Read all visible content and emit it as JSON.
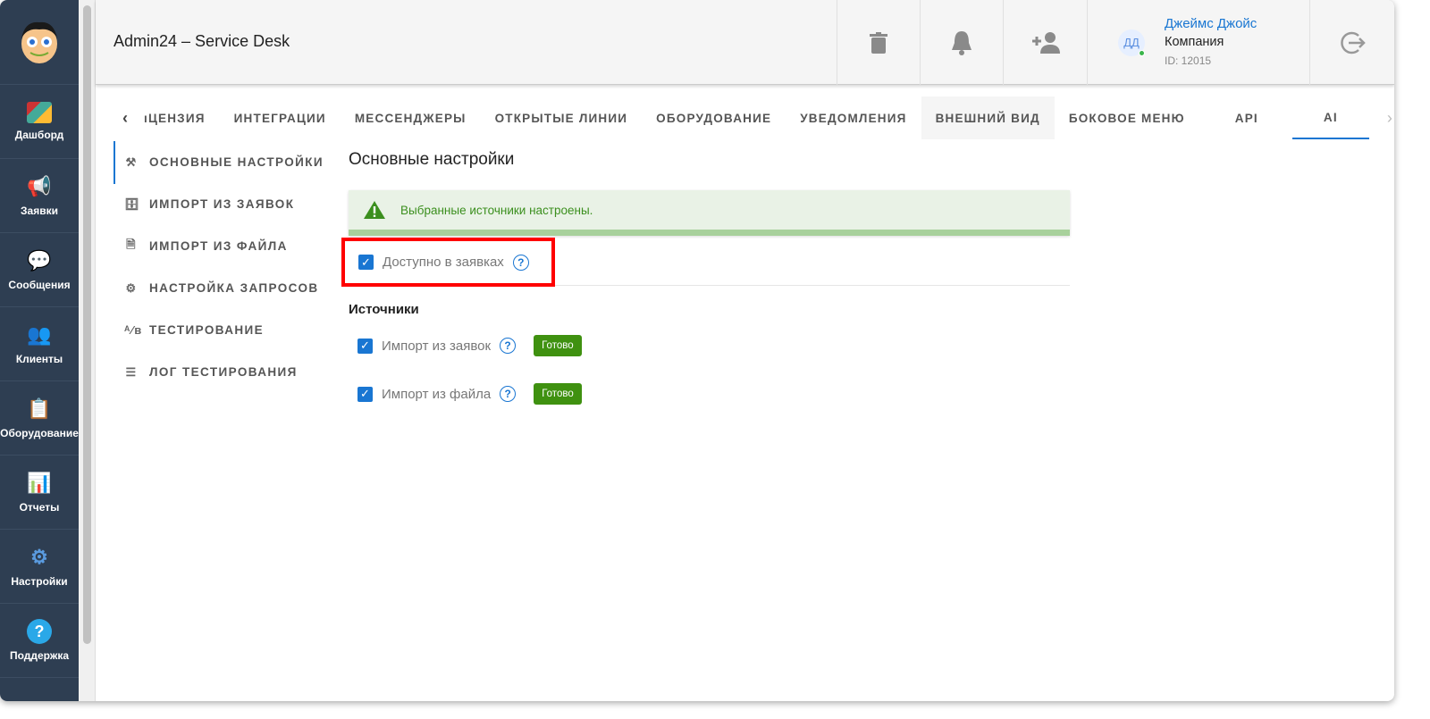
{
  "sidebar": {
    "items": [
      {
        "label": "Дашборд",
        "icon": "dashboard-icon"
      },
      {
        "label": "Заявки",
        "icon": "megaphone-icon"
      },
      {
        "label": "Сообщения",
        "icon": "chat-icon"
      },
      {
        "label": "Клиенты",
        "icon": "clients-icon"
      },
      {
        "label": "Оборудование",
        "icon": "equipment-icon"
      },
      {
        "label": "Отчеты",
        "icon": "report-icon"
      },
      {
        "label": "Настройки",
        "icon": "gear-icon"
      },
      {
        "label": "Поддержка",
        "icon": "help-icon"
      }
    ]
  },
  "header": {
    "title": "Admin24 – Service Desk",
    "user": {
      "initials": "ДД",
      "name": "Джеймс Джойс",
      "company": "Компания",
      "id": "ID: 12015"
    }
  },
  "tabs": [
    "ıЦЕНЗИЯ",
    "ИНТЕГРАЦИИ",
    "МЕССЕНДЖЕРЫ",
    "ОТКРЫТЫЕ ЛИНИИ",
    "ОБОРУДОВАНИЕ",
    "УВЕДОМЛЕНИЯ",
    "ВНЕШНИЙ ВИД",
    "БОКОВОЕ МЕНЮ",
    "API",
    "AI"
  ],
  "menu": [
    "ОСНОВНЫЕ НАСТРОЙКИ",
    "ИМПОРТ ИЗ ЗАЯВОК",
    "ИМПОРТ ИЗ ФАЙЛА",
    "НАСТРОЙКА ЗАПРОСОВ",
    "ТЕСТИРОВАНИЕ",
    "ЛОГ ТЕСТИРОВАНИЯ"
  ],
  "content": {
    "title": "Основные настройки",
    "alert": "Выбранные источники настроены.",
    "available": {
      "label": "Доступно в заявках",
      "checked": true
    },
    "sources_title": "Источники",
    "sources": [
      {
        "label": "Импорт из заявок",
        "checked": true,
        "status": "Готово"
      },
      {
        "label": "Импорт из файла",
        "checked": true,
        "status": "Готово"
      }
    ]
  },
  "colors": {
    "accent": "#1976d2",
    "sidebar": "#2e3e52",
    "success": "#3f9110",
    "highlight": "#ff0000"
  }
}
